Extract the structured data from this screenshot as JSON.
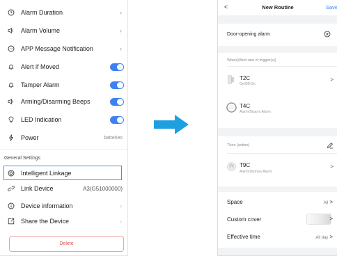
{
  "left_screen": {
    "settings": [
      {
        "label": "Alarm Duration",
        "icon": "clock-icon",
        "control": "chevron"
      },
      {
        "label": "Alarm Volume",
        "icon": "speaker-icon",
        "control": "chevron"
      },
      {
        "label": "APP Message Notification",
        "icon": "message-icon",
        "control": "chevron"
      },
      {
        "label": "Alert if Moved",
        "icon": "bell-icon",
        "control": "toggle",
        "enabled": true
      },
      {
        "label": "Tamper Alarm",
        "icon": "bell-icon",
        "control": "toggle",
        "enabled": true
      },
      {
        "label": "Arming/Disarming Beeps",
        "icon": "speaker-icon",
        "control": "toggle",
        "enabled": true
      },
      {
        "label": "LED Indication",
        "icon": "bulb-icon",
        "control": "toggle",
        "enabled": true
      },
      {
        "label": "Power",
        "icon": "lightning-icon",
        "control": "value",
        "value": "batteries"
      }
    ],
    "general_settings_label": "General Settings",
    "general": [
      {
        "label": "Intelligent Linkage",
        "icon": "linkage-icon",
        "highlighted": true
      },
      {
        "label": "Link Device",
        "icon": "link-icon",
        "value": "A3(G51000000)"
      },
      {
        "label": "Device information",
        "icon": "info-icon",
        "control": "chevron"
      },
      {
        "label": "Share the Device",
        "icon": "share-icon",
        "control": "chevron"
      }
    ],
    "delete_label": "Delete"
  },
  "right_screen": {
    "back": "<",
    "title": "New Routine",
    "save_label": "Save",
    "routine_name": "Door-opening alarm",
    "when_label": "When(Meet one of trigger(s))",
    "triggers": [
      {
        "name": "T2C",
        "status": "On/Off:On",
        "icon": "door-sensor-icon"
      },
      {
        "name": "T4C",
        "status": "Alarm/Disarm:Alarm",
        "icon": "motion-sensor-icon"
      }
    ],
    "then_label": "Then (action)",
    "actions": [
      {
        "name": "T9C",
        "status": "Alarm/Dismiss:Alarm",
        "icon": "siren-icon"
      }
    ],
    "space_label": "Space",
    "space_value": "All",
    "cover_label": "Custom cover",
    "effective_label": "Effective time",
    "effective_value": "All day",
    "chevron": ">"
  },
  "colors": {
    "accent": "#3c82f0",
    "delete_red": "#e15050",
    "arrow": "#1e9fe0"
  }
}
